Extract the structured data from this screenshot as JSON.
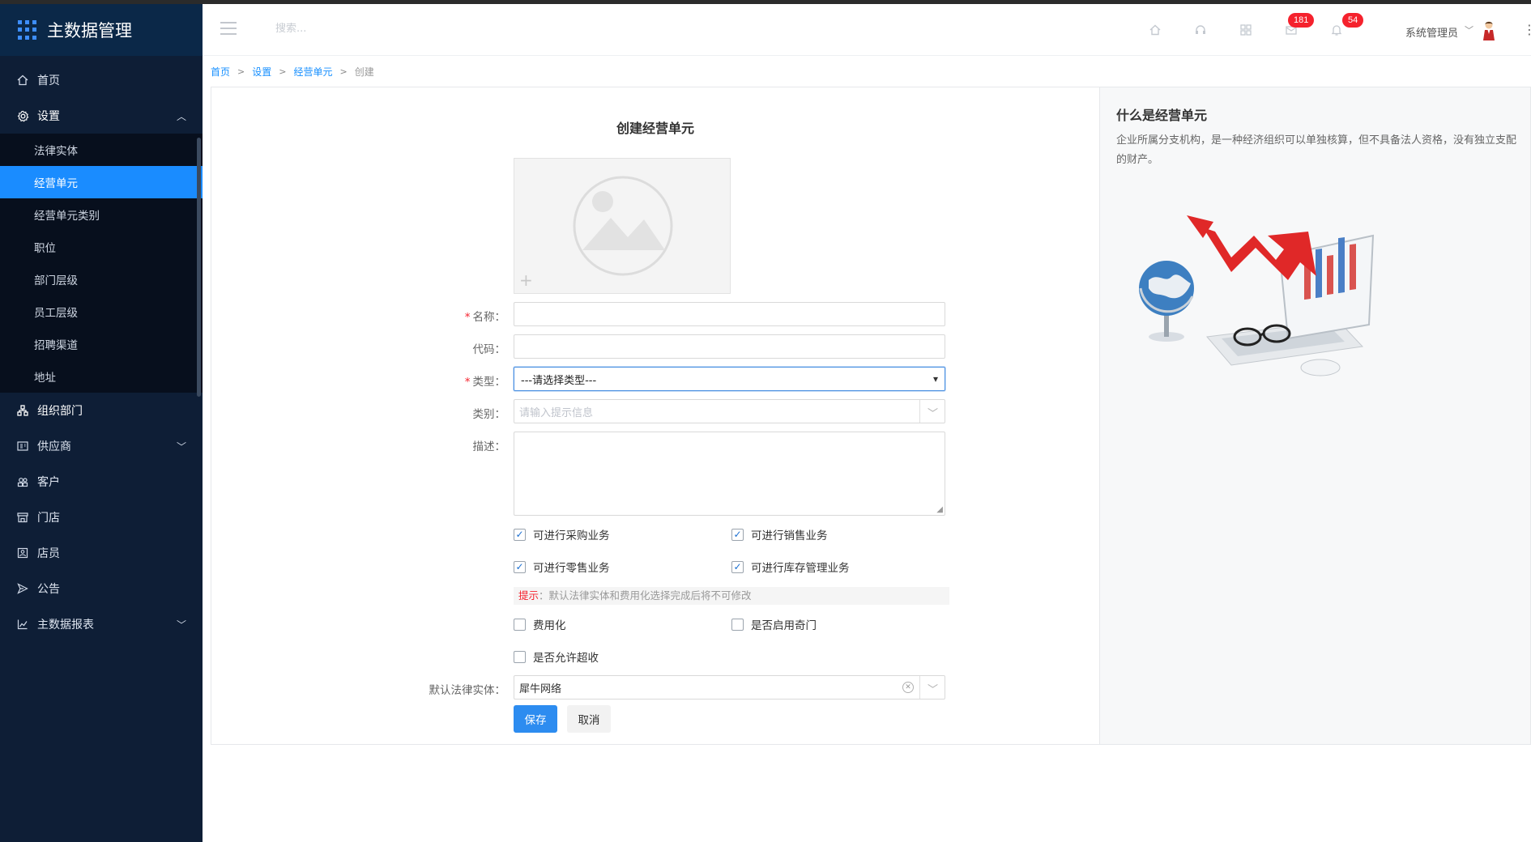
{
  "app": {
    "title": "主数据管理"
  },
  "sidebar": {
    "items": [
      {
        "label": "首页",
        "icon": "home-icon"
      },
      {
        "label": "设置",
        "icon": "gear-icon",
        "open": true,
        "children": [
          "法律实体",
          "经营单元",
          "经营单元类别",
          "职位",
          "部门层级",
          "员工层级",
          "招聘渠道",
          "地址"
        ],
        "active_child": "经营单元"
      },
      {
        "label": "组织部门",
        "icon": "org-icon"
      },
      {
        "label": "供应商",
        "icon": "supplier-icon",
        "has_children": true
      },
      {
        "label": "客户",
        "icon": "customer-icon"
      },
      {
        "label": "门店",
        "icon": "store-icon"
      },
      {
        "label": "店员",
        "icon": "clerk-icon"
      },
      {
        "label": "公告",
        "icon": "announce-icon"
      },
      {
        "label": "主数据报表",
        "icon": "chart-icon",
        "has_children": true
      }
    ]
  },
  "header": {
    "search_placeholder": "搜索...",
    "badges": {
      "messages": "181",
      "notifications": "54"
    },
    "user_name": "系统管理员"
  },
  "breadcrumb": {
    "items": [
      "首页",
      "设置",
      "经营单元"
    ],
    "current": "创建"
  },
  "form": {
    "title": "创建经营单元",
    "name_label": "名称：",
    "code_label": "代码：",
    "type_label": "类型：",
    "type_value": "---请选择类型---",
    "category_label": "类别：",
    "category_placeholder": "请输入提示信息",
    "desc_label": "描述：",
    "checkboxes": {
      "purchase": {
        "label": "可进行采购业务",
        "checked": true
      },
      "sales": {
        "label": "可进行销售业务",
        "checked": true
      },
      "retail": {
        "label": "可进行零售业务",
        "checked": true
      },
      "inventory": {
        "label": "可进行库存管理业务",
        "checked": true
      },
      "expense": {
        "label": "费用化",
        "checked": false
      },
      "odd_door": {
        "label": "是否启用奇门",
        "checked": false
      },
      "over_receive": {
        "label": "是否允许超收",
        "checked": false
      }
    },
    "tip_prefix": "提示",
    "tip_text": "：默认法律实体和费用化选择完成后将不可修改",
    "legal_entity_label": "默认法律实体：",
    "legal_entity_value": "犀牛网络",
    "save_label": "保存",
    "cancel_label": "取消"
  },
  "info": {
    "title": "什么是经营单元",
    "description": "企业所属分支机构，是一种经济组织可以单独核算，但不具备法人资格，没有独立支配的财产。"
  },
  "colors": {
    "sidebar_bg": "#0e1e36",
    "accent": "#1a8cff",
    "badge": "#f5222d",
    "required": "#f5222d"
  }
}
